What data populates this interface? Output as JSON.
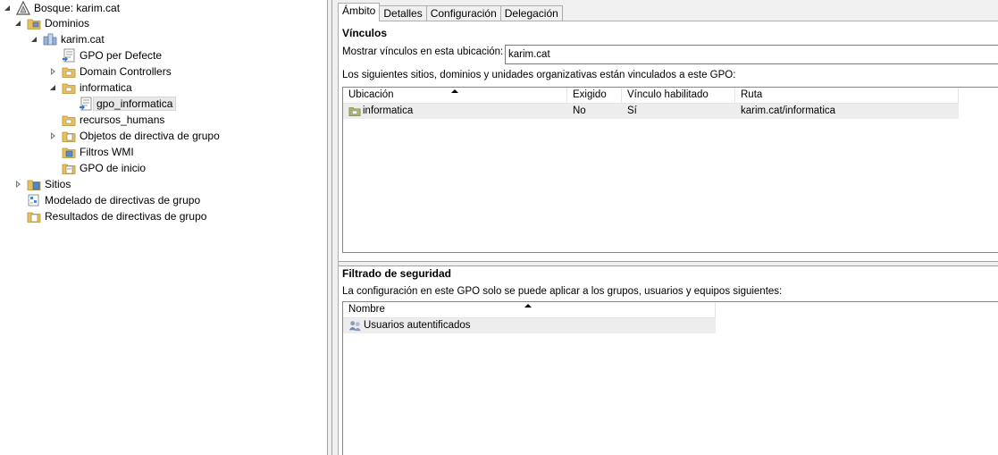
{
  "tree": {
    "forest": "Bosque: karim.cat",
    "domains": "Dominios",
    "domain": "karim.cat",
    "gpo_default": "GPO per Defecte",
    "domain_controllers": "Domain Controllers",
    "ou_informatica": "informatica",
    "gpo_informatica": "gpo_informatica",
    "ou_recursos": "recursos_humans",
    "gpo_objects": "Objetos de directiva de grupo",
    "wmi_filters": "Filtros WMI",
    "starter_gpos": "GPO de inicio",
    "sites": "Sitios",
    "gp_modeling": "Modelado de directivas de grupo",
    "gp_results": "Resultados de directivas de grupo"
  },
  "tabs": [
    "Ámbito",
    "Detalles",
    "Configuración",
    "Delegación"
  ],
  "links": {
    "title": "Vínculos",
    "show_label": "Mostrar vínculos en esta ubicación:",
    "location_value": "karim.cat",
    "description": "Los siguientes sitios, dominios y unidades organizativas están vinculados a este GPO:",
    "columns": [
      "Ubicación",
      "Exigido",
      "Vínculo habilitado",
      "Ruta"
    ],
    "rows": [
      {
        "location": "informatica",
        "enforced": "No",
        "enabled": "Sí",
        "path": "karim.cat/informatica"
      }
    ]
  },
  "security": {
    "title": "Filtrado de seguridad",
    "description": "La configuración en este GPO solo se puede aplicar a los grupos, usuarios y equipos siguientes:",
    "columns": [
      "Nombre"
    ],
    "rows": [
      {
        "name": "Usuarios autentificados"
      }
    ]
  },
  "colors": {
    "folder": "#e8c15c",
    "selection": "#e8e8e8",
    "panel_bg": "#f0f0f0"
  }
}
